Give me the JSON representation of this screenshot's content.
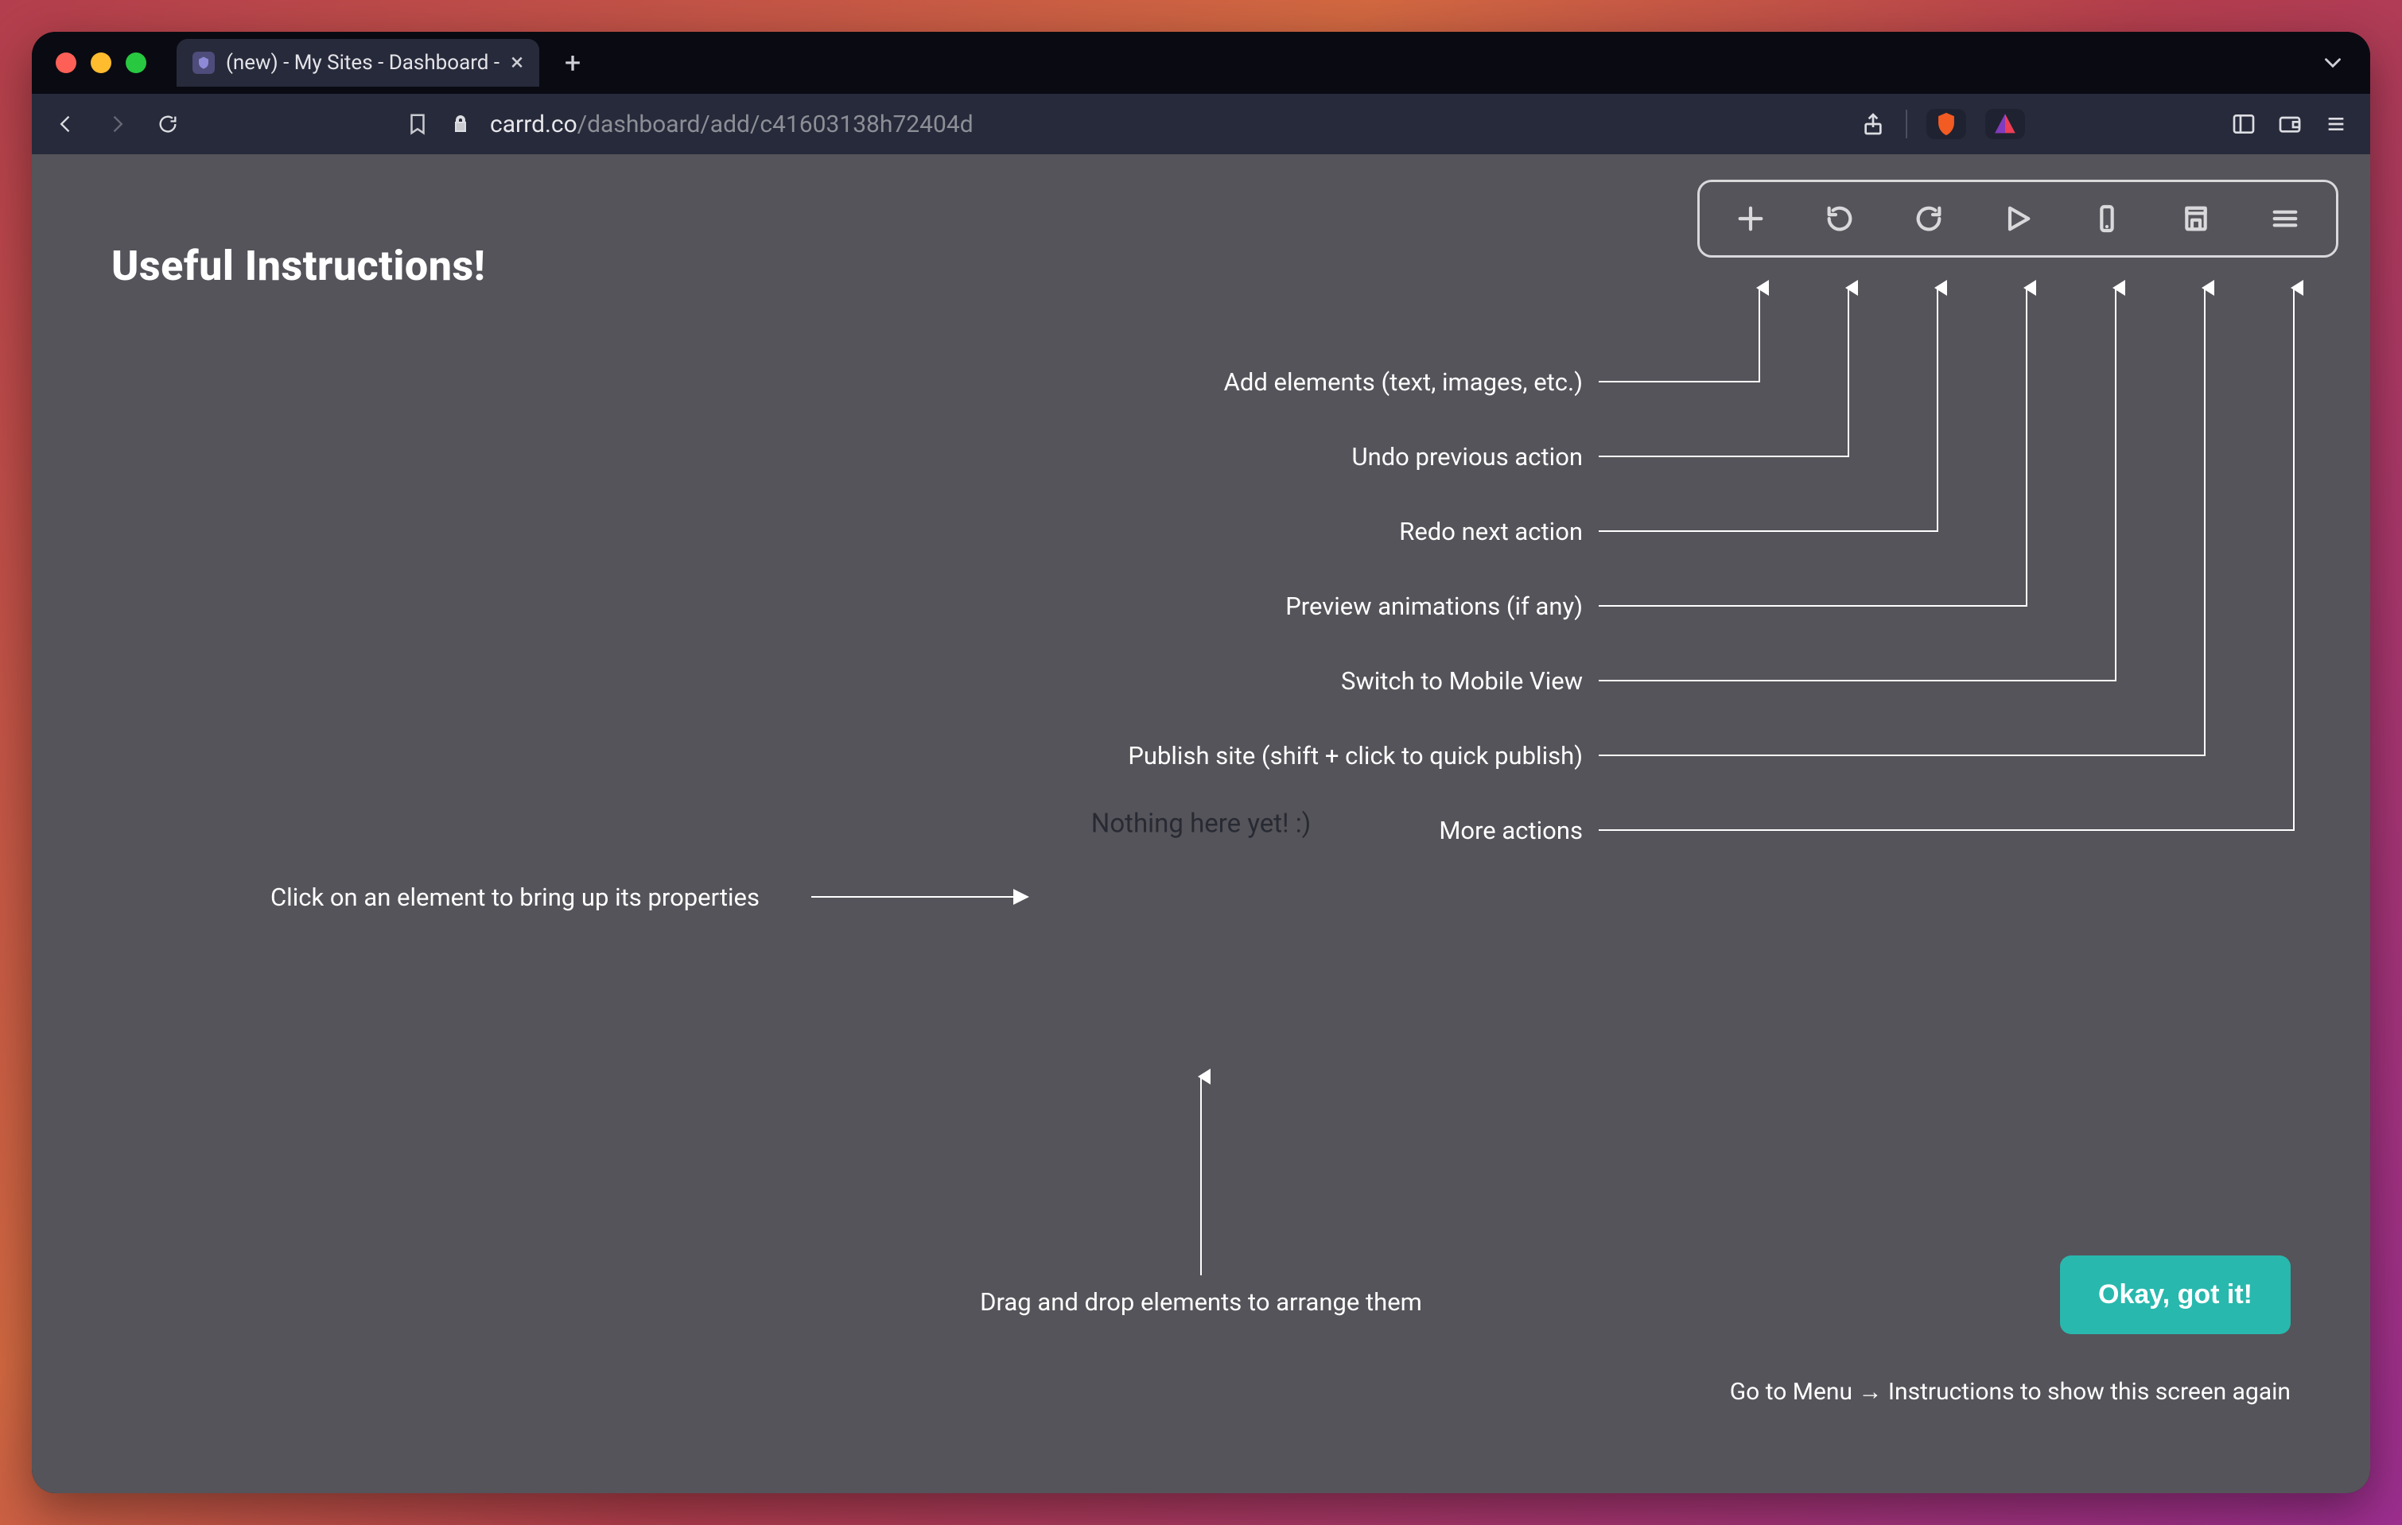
{
  "browser": {
    "tab_title": "(new) - My Sites - Dashboard - ",
    "url_host": "carrd.co",
    "url_path": "/dashboard/add/c41603138h72404d"
  },
  "page": {
    "heading": "Useful Instructions!",
    "canvas_placeholder": "Nothing here yet! :)",
    "instructions": {
      "add": "Add elements (text, images, etc.)",
      "undo": "Undo previous action",
      "redo": "Redo next action",
      "preview": "Preview animations (if any)",
      "mobile": "Switch to Mobile View",
      "publish": "Publish site (shift + click to quick publish)",
      "more": "More actions",
      "click_element": "Click on an element to bring up its properties",
      "drag_drop": "Drag and drop elements to arrange them"
    },
    "ok_button": "Okay, got it!",
    "footer_note": "Go to Menu → Instructions to show this screen again"
  },
  "colors": {
    "panel": "#55545a",
    "teal": "#28b8ae",
    "toolbar_border": "#d9d9dc"
  }
}
